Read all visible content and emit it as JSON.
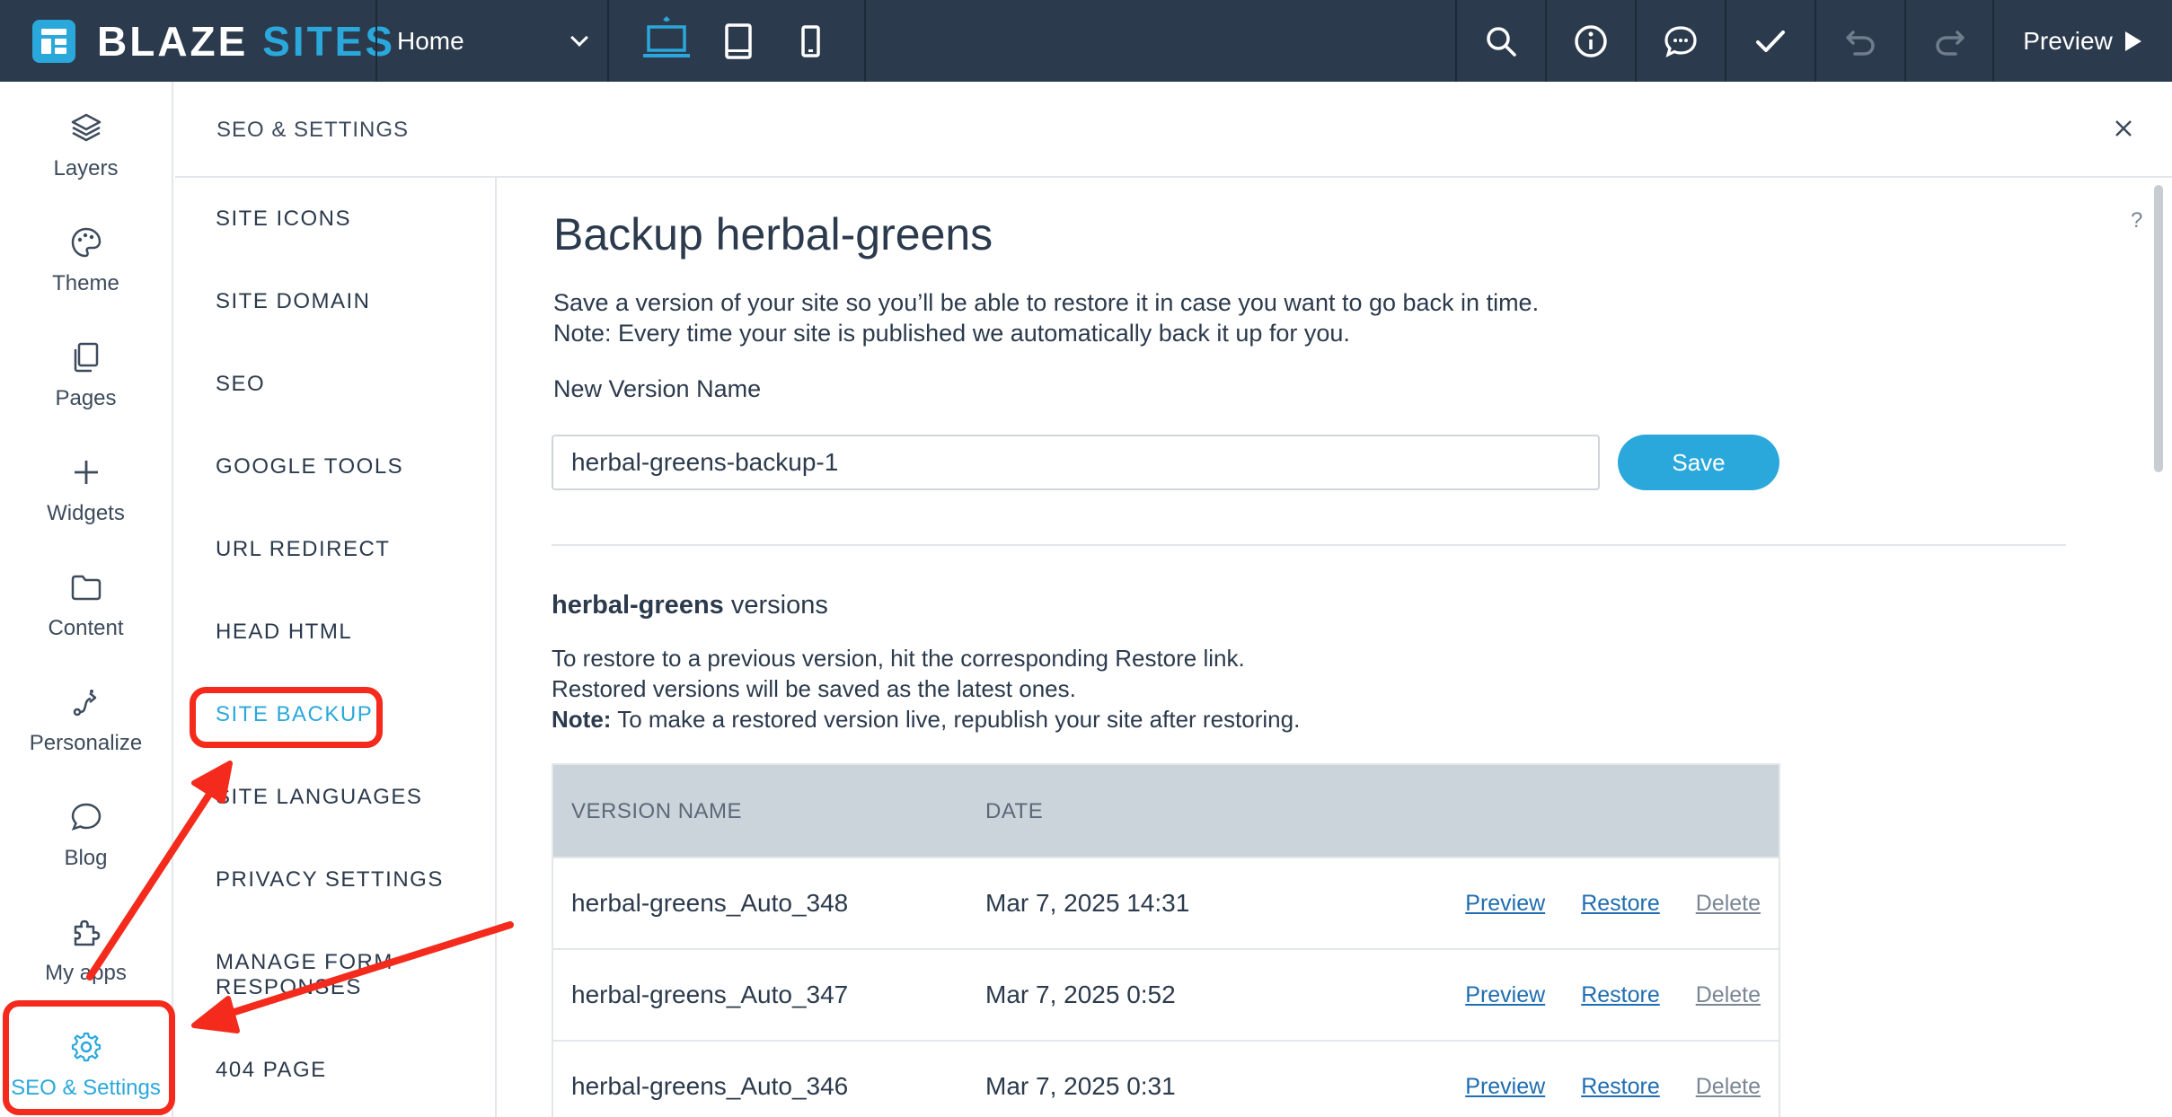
{
  "app": {
    "logo_word1": "BLAZE",
    "logo_word2": "SITES",
    "page_selector": "Home",
    "preview_label": "Preview",
    "toolbar_icons": [
      "search-icon",
      "info-icon",
      "chat-icon",
      "check-icon",
      "undo-icon",
      "redo-icon"
    ],
    "device_icons": [
      "desktop-icon",
      "tablet-icon",
      "mobile-icon"
    ],
    "accent_color": "#2aa8dc",
    "topbar_color": "#2b3a4c"
  },
  "rail": {
    "items": [
      {
        "label": "Layers",
        "icon": "layers-icon"
      },
      {
        "label": "Theme",
        "icon": "palette-icon"
      },
      {
        "label": "Pages",
        "icon": "pages-icon"
      },
      {
        "label": "Widgets",
        "icon": "plus-icon"
      },
      {
        "label": "Content",
        "icon": "folder-icon"
      },
      {
        "label": "Personalize",
        "icon": "personalize-icon"
      },
      {
        "label": "Blog",
        "icon": "chat-bubble-icon"
      },
      {
        "label": "My apps",
        "icon": "puzzle-icon"
      },
      {
        "label": "SEO & Settings",
        "icon": "gear-icon",
        "active": true
      }
    ]
  },
  "panel": {
    "title": "SEO & SETTINGS",
    "help": "?",
    "menu": [
      "SITE ICONS",
      "SITE DOMAIN",
      "SEO",
      "GOOGLE TOOLS",
      "URL REDIRECT",
      "HEAD HTML",
      "SITE BACKUP",
      "SITE LANGUAGES",
      "PRIVACY SETTINGS",
      "MANAGE FORM RESPONSES",
      "404 PAGE"
    ],
    "active_menu": "SITE BACKUP"
  },
  "backup": {
    "heading": "Backup herbal-greens",
    "desc_line1": "Save a version of your site so you’ll be able to restore it in case you want to go back in time.",
    "desc_line2": "Note: Every time your site is published we automatically back it up for you.",
    "field_label": "New Version Name",
    "field_value": "herbal-greens-backup-1",
    "save_label": "Save",
    "versions_site": "herbal-greens",
    "versions_suffix": " versions",
    "info_line1": "To restore to a previous version, hit the corresponding Restore link.",
    "info_line2": "Restored versions will be saved as the latest ones.",
    "info_note_label": "Note:",
    "info_line3": " To make a restored version live, republish your site after restoring.",
    "table": {
      "headers": [
        "VERSION NAME",
        "DATE"
      ],
      "rows": [
        {
          "name": "herbal-greens_Auto_348",
          "date": "Mar 7, 2025 14:31",
          "preview": "Preview",
          "restore": "Restore",
          "delete": "Delete"
        },
        {
          "name": "herbal-greens_Auto_347",
          "date": "Mar 7, 2025 0:52",
          "preview": "Preview",
          "restore": "Restore",
          "delete": "Delete"
        },
        {
          "name": "herbal-greens_Auto_346",
          "date": "Mar 7, 2025 0:31",
          "preview": "Preview",
          "restore": "Restore",
          "delete": "Delete"
        }
      ]
    }
  },
  "annotation_color": "#f42a1c"
}
